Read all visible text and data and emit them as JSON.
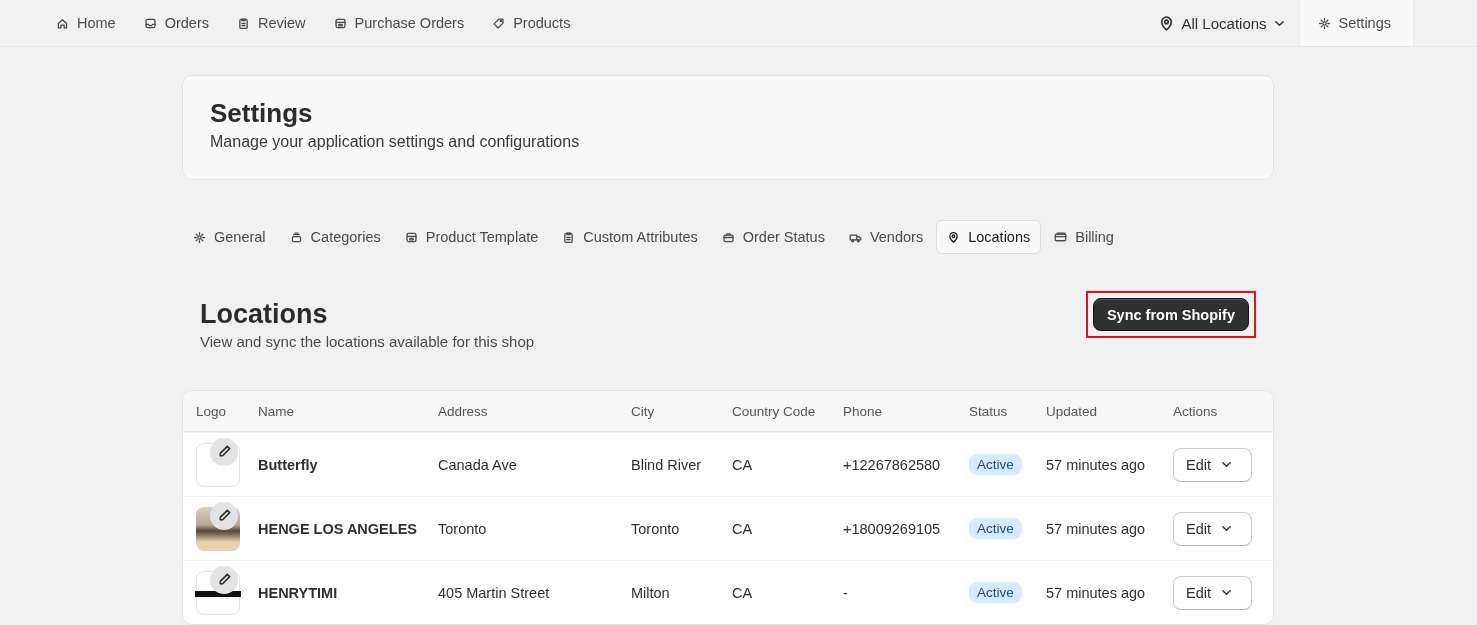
{
  "top_nav": {
    "items": [
      {
        "label": "Home",
        "selected": false
      },
      {
        "label": "Orders",
        "selected": false
      },
      {
        "label": "Review",
        "selected": false
      },
      {
        "label": "Purchase Orders",
        "selected": false
      },
      {
        "label": "Products",
        "selected": false
      }
    ],
    "location_menu": {
      "label": "All Locations"
    },
    "settings_item": {
      "label": "Settings",
      "selected": true
    }
  },
  "page_header": {
    "title": "Settings",
    "subtitle": "Manage your application settings and configurations"
  },
  "tabs": [
    {
      "label": "General",
      "selected": false
    },
    {
      "label": "Categories",
      "selected": false
    },
    {
      "label": "Product Template",
      "selected": false
    },
    {
      "label": "Custom Attributes",
      "selected": false
    },
    {
      "label": "Order Status",
      "selected": false
    },
    {
      "label": "Vendors",
      "selected": false
    },
    {
      "label": "Locations",
      "selected": true
    },
    {
      "label": "Billing",
      "selected": false
    }
  ],
  "section": {
    "title": "Locations",
    "subtitle": "View and sync the locations available for this shop",
    "sync_button": {
      "label": "Sync from Shopify",
      "highlighted": true
    }
  },
  "table": {
    "columns": [
      "Logo",
      "Name",
      "Address",
      "City",
      "Country Code",
      "Phone",
      "Status",
      "Updated",
      "Actions"
    ],
    "rows": [
      {
        "kind": "empty",
        "name": "Butterfly",
        "address": "Canada Ave",
        "city": "Blind River",
        "country_code": "CA",
        "phone": "+12267862580",
        "status": "Active",
        "updated": "57 minutes ago",
        "action": "Edit"
      },
      {
        "kind": "photo",
        "name": "HENGE LOS ANGELES",
        "address": "Toronto",
        "city": "Toronto",
        "country_code": "CA",
        "phone": "+18009269105",
        "status": "Active",
        "updated": "57 minutes ago",
        "action": "Edit"
      },
      {
        "kind": "wordmark",
        "name": "HENRYTIMI",
        "address": "405 Martin Street",
        "city": "Milton",
        "country_code": "CA",
        "phone": "-",
        "status": "Active",
        "updated": "57 minutes ago",
        "action": "Edit"
      }
    ]
  }
}
